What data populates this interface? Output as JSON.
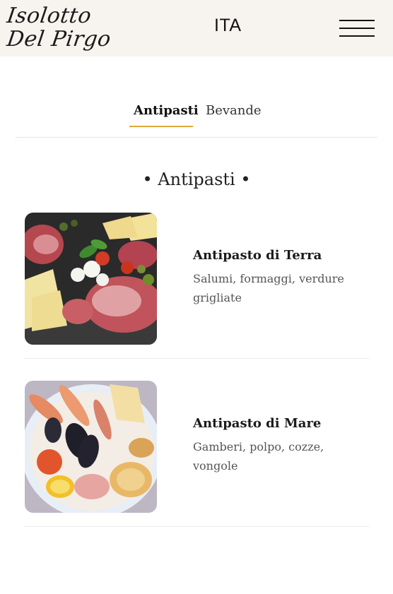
{
  "header": {
    "logo_line1": "Isolotto",
    "logo_line2": "Del Pirgo",
    "language": "ITA",
    "menu_icon": "hamburger-menu-icon"
  },
  "tabs": [
    {
      "label": "Antipasti",
      "active": true
    },
    {
      "label": "Bevande",
      "active": false
    }
  ],
  "accent_color": "#e0a83a",
  "section": {
    "title": "• Antipasti •"
  },
  "items": [
    {
      "name": "Antipasto di Terra",
      "description": "Salumi, formaggi, verdure grigliate",
      "image": "cured-meats-cheese-platter-photo"
    },
    {
      "name": "Antipasto di Mare",
      "description": "Gamberi, polpo, cozze, vongole",
      "image": "seafood-platter-photo"
    }
  ]
}
